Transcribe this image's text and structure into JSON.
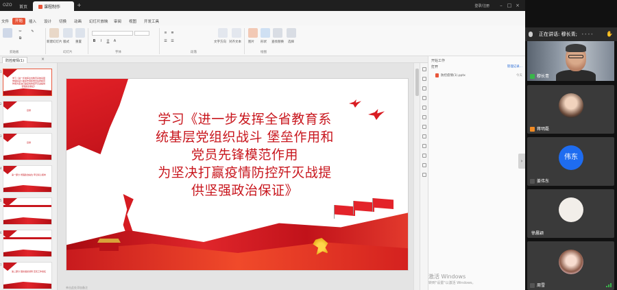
{
  "app": {
    "brand": "OZO",
    "home_tab": "首页",
    "doc_tab": "课程制作",
    "login_text": "登录/注册",
    "menus": [
      "文件",
      "开始",
      "插入",
      "设计",
      "切换",
      "动画",
      "幻灯片放映",
      "审阅",
      "视图",
      "开发工具"
    ],
    "active_menu": "开始",
    "ribbon": {
      "groups": [
        "剪贴板",
        "幻灯片",
        "字体",
        "段落",
        "绘图"
      ],
      "buttons": [
        "新建幻灯片",
        "版式",
        "重置",
        "文字方向",
        "对齐文本",
        "图片",
        "形状",
        "排列",
        "查找替换",
        "选择"
      ]
    },
    "file_tab": "防控疫情(1)",
    "right_pane": {
      "header": "开始工作",
      "open_label": "打开",
      "manage_link": "管理记录...",
      "recent_file": "防控疫情(1).pptx",
      "recent_date": "今天"
    },
    "watermark": {
      "line1": "激活 Windows",
      "line2": "转到\"设置\"以激活 Windows。"
    },
    "notes_placeholder": "单击此处添加备注"
  },
  "slide": {
    "title_lines": [
      "学习《进一步发挥全省教育系",
      "统基层党组织战斗 堡垒作用和",
      "党员先锋模范作用",
      "为坚决打赢疫情防控歼灭战提",
      "供坚强政治保证》"
    ],
    "title_color": "#c8161d"
  },
  "thumbnails": [
    {
      "num": "1",
      "text": "学习《进一步发挥全省教育系统基层党组织战斗堡垒作用和党员先锋模范作用为坚决打赢疫情防控歼灭战提供坚强政治保证》",
      "active": true
    },
    {
      "num": "2",
      "text": "目录"
    },
    {
      "num": "3",
      "text": "目录"
    },
    {
      "num": "4",
      "text": "第一部分 增强政治站位 牢记初心使命"
    },
    {
      "num": "5",
      "text": ""
    },
    {
      "num": "6",
      "text": ""
    },
    {
      "num": "7",
      "text": "第二部分 强化组织领导 压实工作责任"
    }
  ],
  "meeting": {
    "speaking_label": "正在讲话: 穆长青;",
    "participants": [
      {
        "name": "穆长青",
        "type": "video",
        "mic": "green"
      },
      {
        "name": "蒋明磊",
        "type": "photo",
        "mic": "orange"
      },
      {
        "name": "姜伟东",
        "type": "initials",
        "initials": "伟东",
        "mic": "gray"
      },
      {
        "name": "徐晨颖",
        "type": "light",
        "mic": "none"
      },
      {
        "name": "周雪",
        "type": "girl",
        "mic": "gray"
      }
    ]
  },
  "colors": {
    "accent": "#e8563a",
    "party_red": "#c8161d",
    "avatar_blue": "#1e6cf0"
  }
}
